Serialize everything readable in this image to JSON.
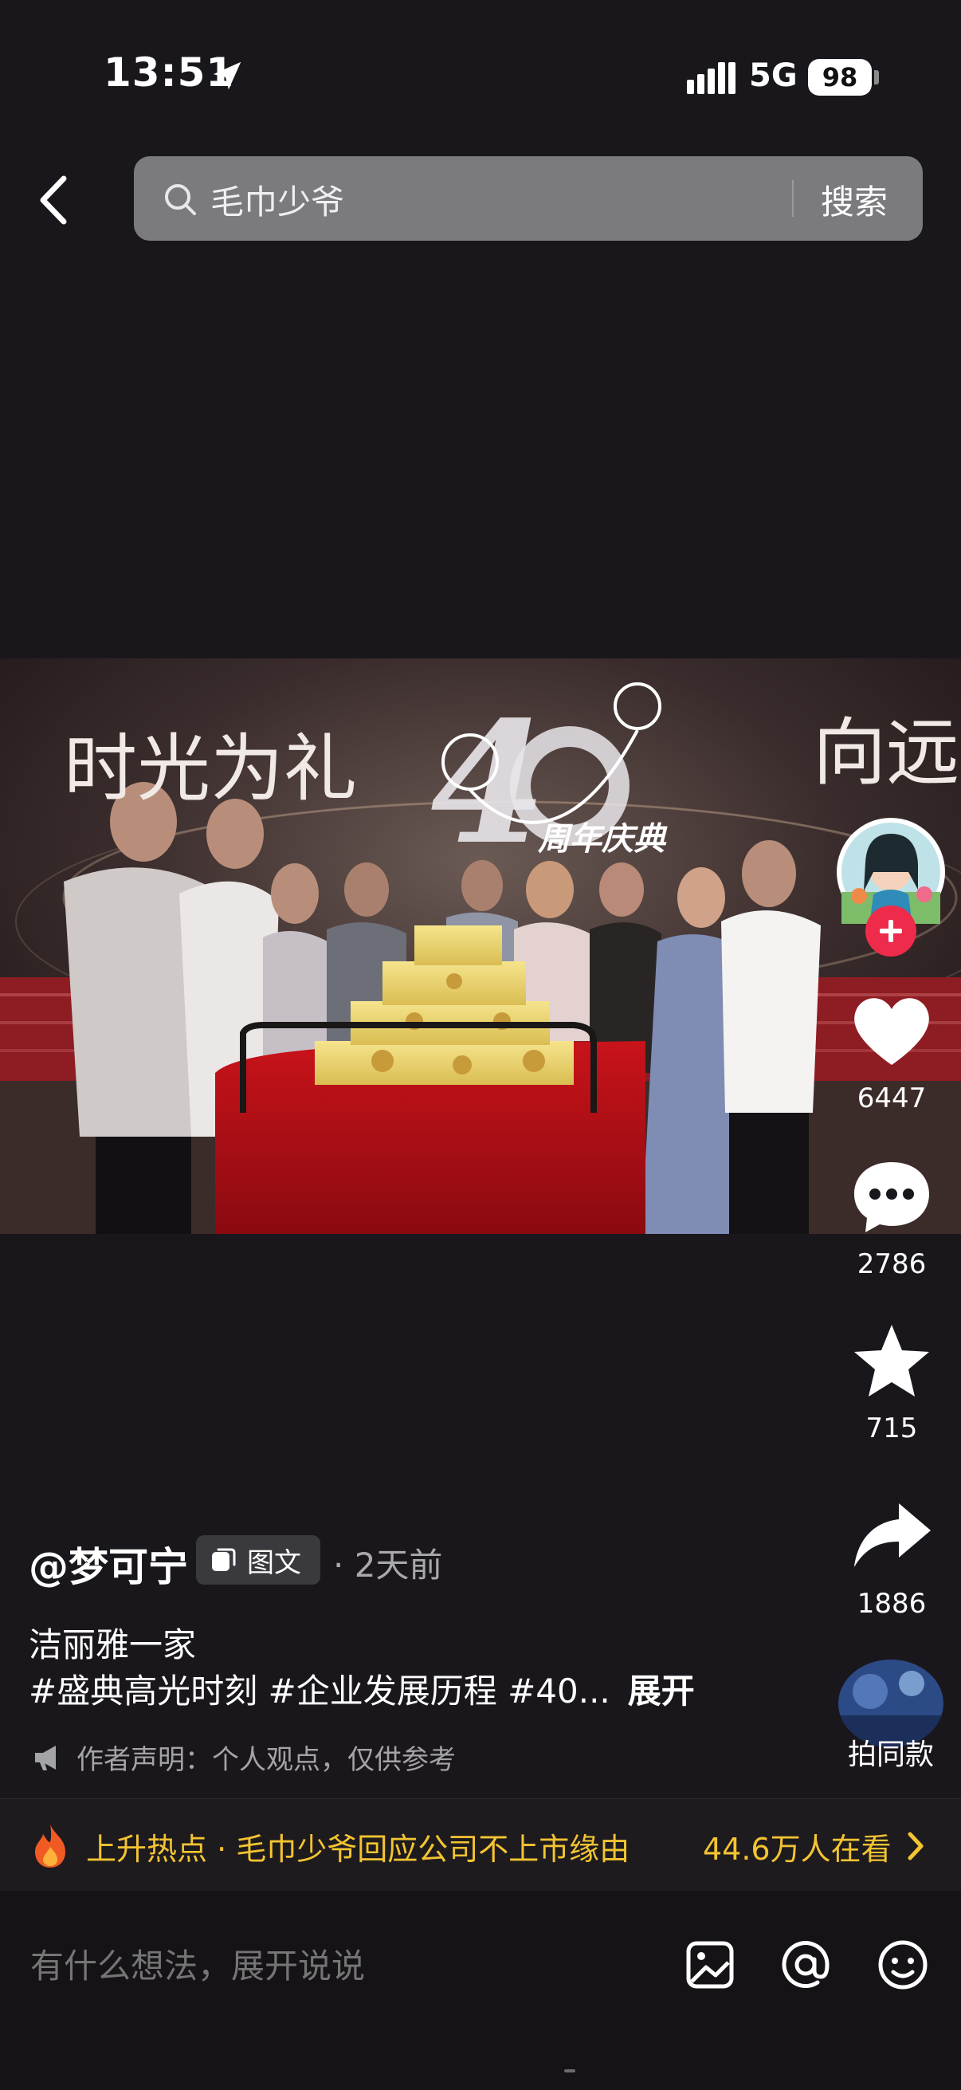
{
  "status_bar": {
    "time": "13:51",
    "network": "5G",
    "battery": "98"
  },
  "header": {
    "search_query": "毛巾少爷",
    "search_button": "搜索",
    "icons": [
      "back-icon",
      "search-icon"
    ]
  },
  "photo": {
    "banner_text_left": "时光为礼",
    "banner_text_right": "向远",
    "logo_number": "40",
    "logo_caption": "周年庆典"
  },
  "rail": {
    "likes": "6447",
    "comments": "2786",
    "favorites": "715",
    "shares": "1886",
    "remix_label": "拍同款",
    "follow_color": "#ee2b4b"
  },
  "post": {
    "author": "@梦可宁",
    "type_badge": "图文",
    "time_ago": "· 2天前",
    "title": "洁丽雅一家",
    "hashtags": "#盛典高光时刻 #企业发展历程 #40...",
    "expand": "展开",
    "declaration": "作者声明：个人观点，仅供参考"
  },
  "hot_banner": {
    "text": "上升热点 · 毛巾少爷回应公司不上市缘由",
    "viewers": "44.6万人在看",
    "accent": "#f3c431"
  },
  "comment_bar": {
    "placeholder": "有什么想法，展开说说",
    "icons": [
      "image-icon",
      "mention-icon",
      "emoji-icon"
    ]
  }
}
